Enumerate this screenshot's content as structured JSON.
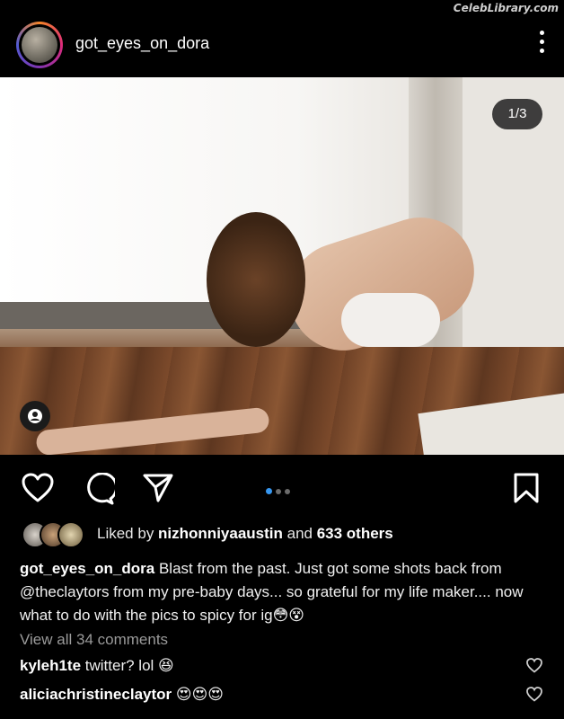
{
  "watermark": "CelebLibrary.com",
  "post": {
    "username": "got_eyes_on_dora",
    "counter": "1/3",
    "carousel": {
      "current": 1,
      "total": 3
    }
  },
  "likes": {
    "prefix": "Liked by ",
    "user": "nizhonniyaaustin",
    "middle": " and ",
    "others": "633 others"
  },
  "caption": {
    "username": "got_eyes_on_dora",
    "text": " Blast from the past. Just got some shots back from @theclaytors from my pre-baby days... so grateful for my life maker.... now what to do with the pics to spicy for ig😳😵"
  },
  "view_comments": "View all 34 comments",
  "comments": [
    {
      "user": "kyleh1te",
      "text": " twitter? lol 😆"
    },
    {
      "user": "aliciachristineclaytor",
      "text": " 😍😍😍"
    }
  ],
  "icons": {
    "like": "heart-icon",
    "comment": "comment-icon",
    "share": "send-icon",
    "save": "bookmark-icon",
    "more": "more-vertical-icon",
    "tag": "person-tag-icon"
  },
  "colors": {
    "background": "#000000",
    "accent": "#3797f0",
    "muted": "#9a9a9a"
  }
}
